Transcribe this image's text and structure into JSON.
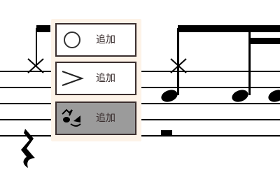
{
  "menu": {
    "items": [
      {
        "icon": "circle-icon",
        "label": "追加"
      },
      {
        "icon": "accent-icon",
        "label": "追加"
      },
      {
        "icon": "ghost-note-icon",
        "label": "追加",
        "selected": true
      }
    ]
  },
  "colors": {
    "staff": "#000000",
    "menu_bg": "#fdf3e8",
    "item_border": "#3a2e2e",
    "item_selected_bg": "#9b9b9b"
  }
}
